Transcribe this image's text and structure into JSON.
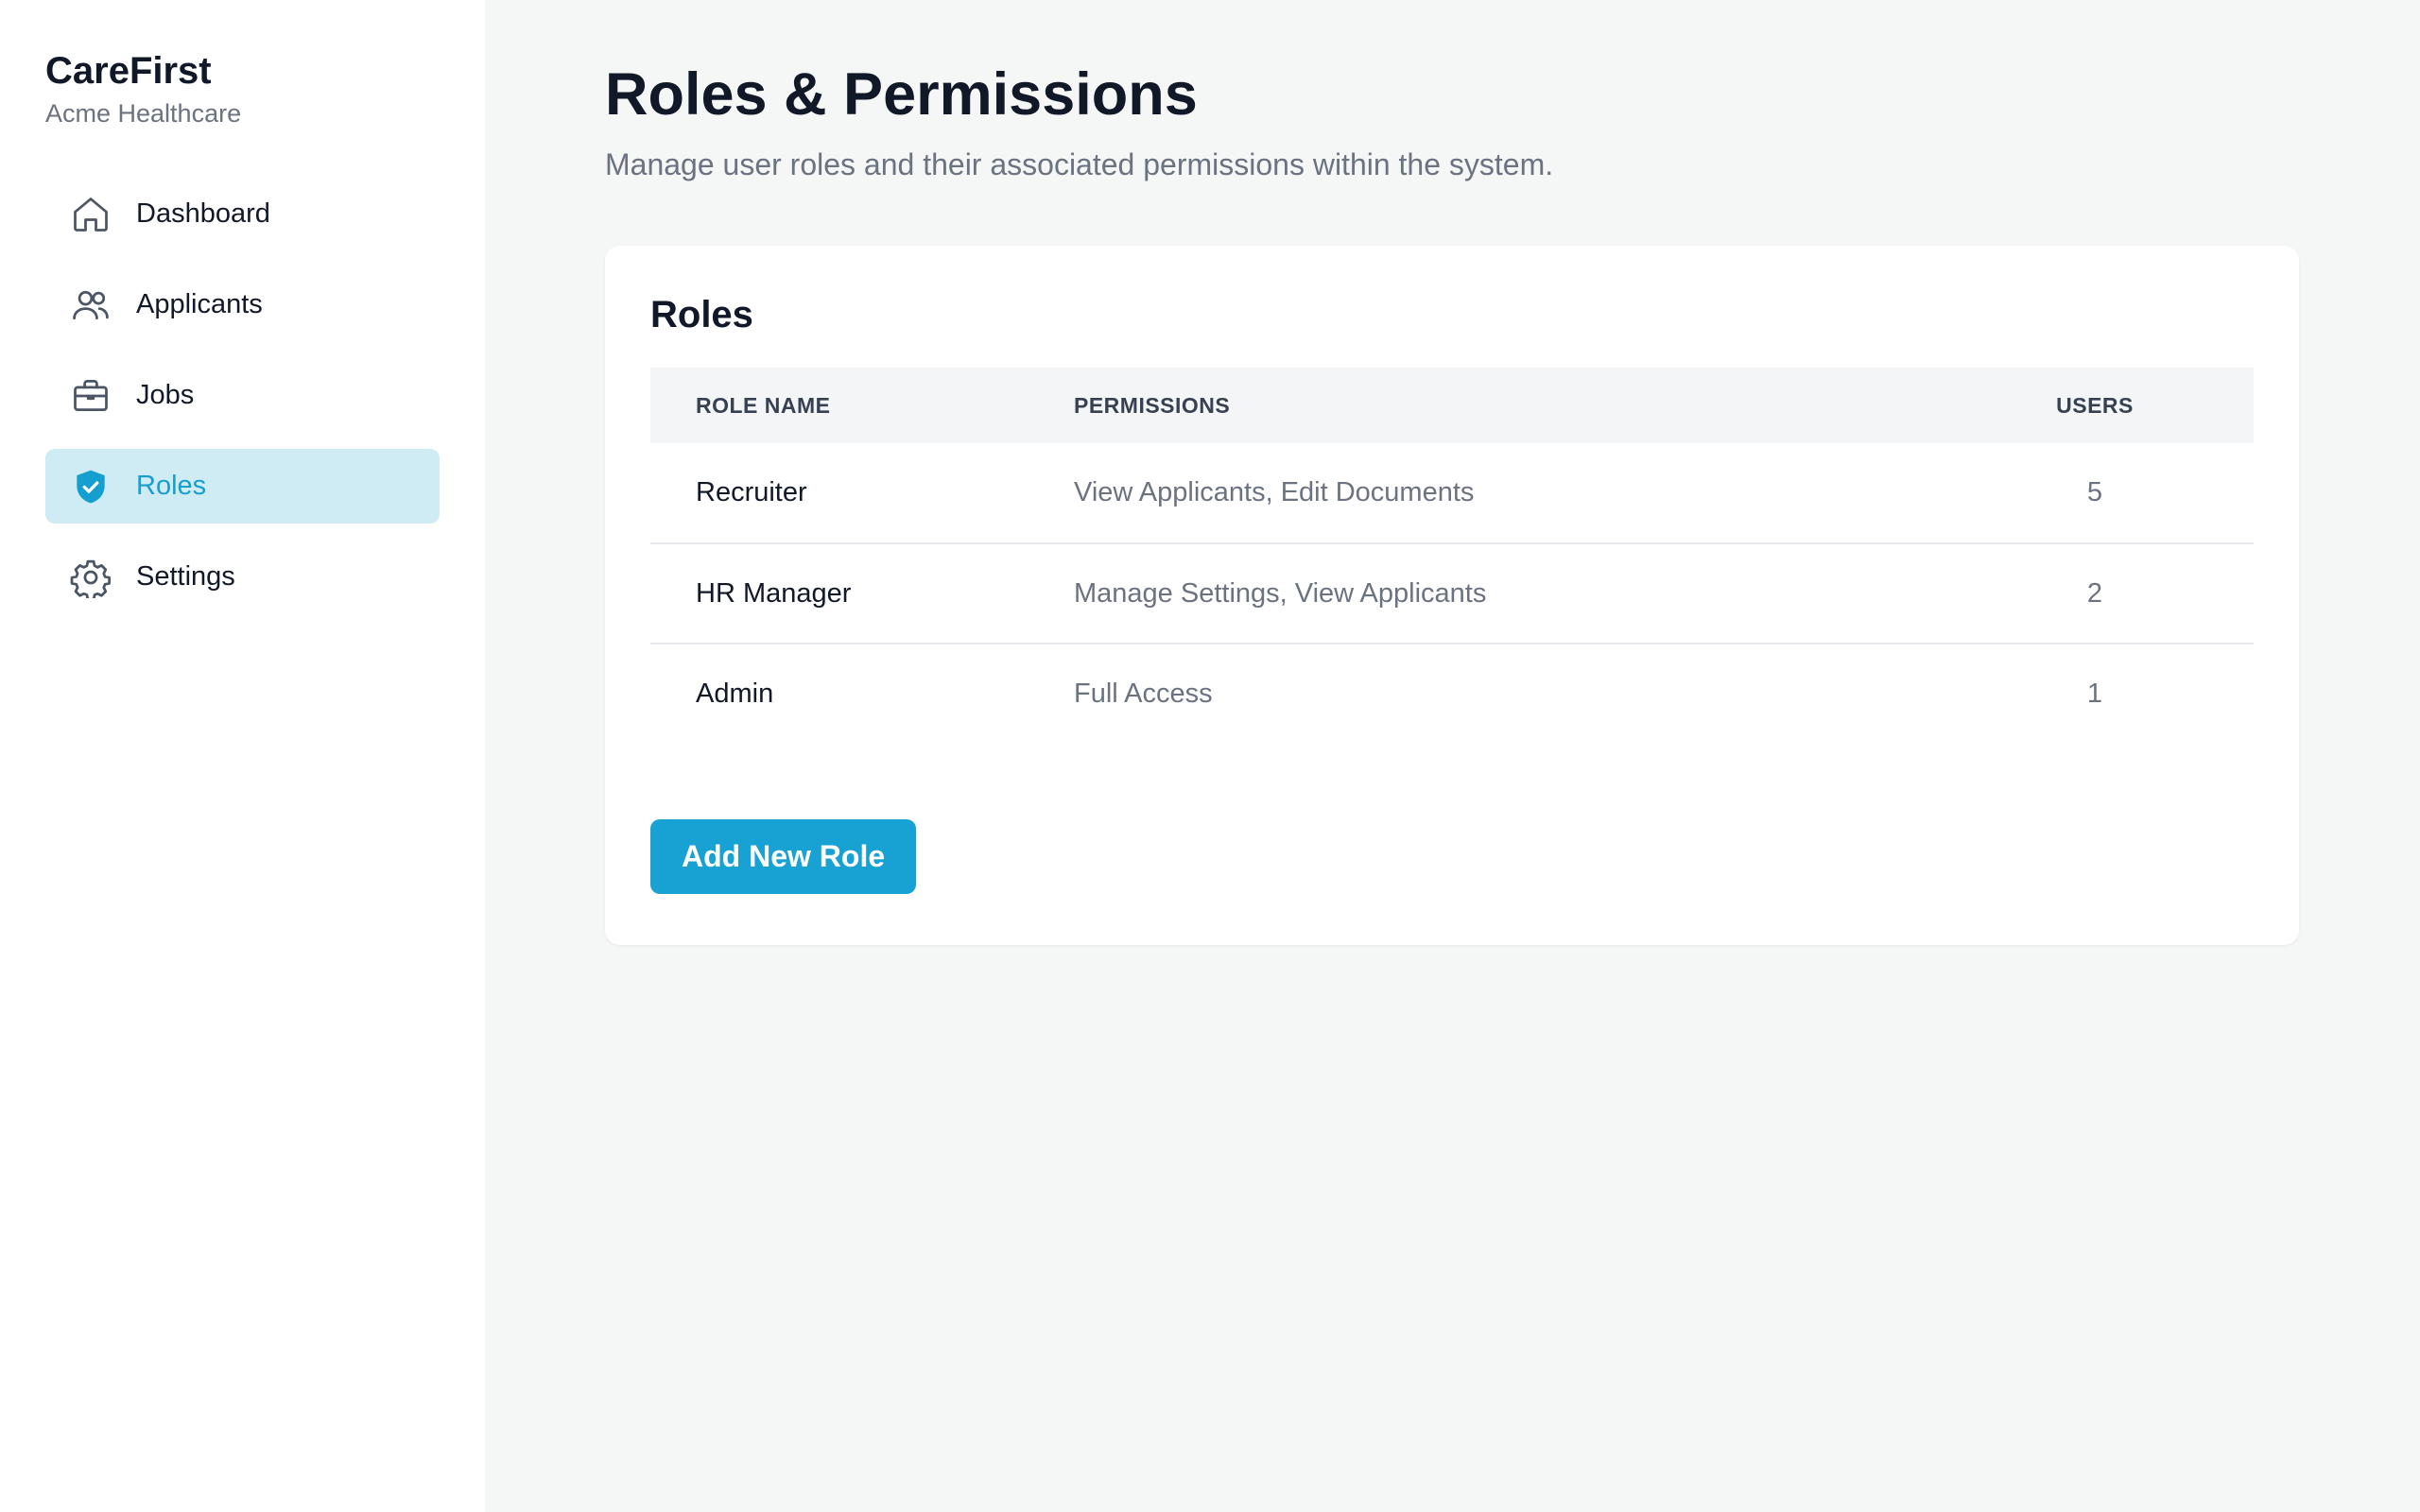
{
  "brand": {
    "name": "CareFirst",
    "organization": "Acme Healthcare"
  },
  "sidebar": {
    "items": [
      {
        "label": "Dashboard",
        "icon": "home-icon",
        "active": false
      },
      {
        "label": "Applicants",
        "icon": "users-icon",
        "active": false
      },
      {
        "label": "Jobs",
        "icon": "briefcase-icon",
        "active": false
      },
      {
        "label": "Roles",
        "icon": "shield-check-icon",
        "active": true
      },
      {
        "label": "Settings",
        "icon": "gear-icon",
        "active": false
      }
    ]
  },
  "page": {
    "title": "Roles & Permissions",
    "subtitle": "Manage user roles and their associated permissions within the system."
  },
  "roles_card": {
    "title": "Roles",
    "columns": [
      "ROLE NAME",
      "PERMISSIONS",
      "USERS"
    ],
    "rows": [
      {
        "role": "Recruiter",
        "permissions": "View Applicants, Edit Documents",
        "users": "5"
      },
      {
        "role": "HR Manager",
        "permissions": "Manage Settings, View Applicants",
        "users": "2"
      },
      {
        "role": "Admin",
        "permissions": "Full Access",
        "users": "1"
      }
    ],
    "add_button_label": "Add New Role"
  },
  "colors": {
    "accent": "#17a2d3",
    "active_nav_bg": "#cfebf4",
    "background": "#f5f7f7"
  }
}
